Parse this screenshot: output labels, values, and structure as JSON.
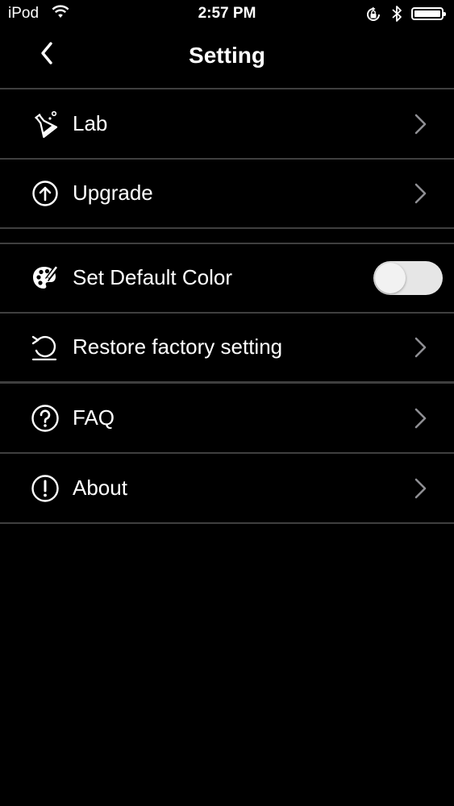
{
  "status": {
    "carrier": "iPod",
    "time": "2:57 PM",
    "wifi_icon": "wifi-icon",
    "lock_icon": "rotation-lock-icon",
    "bluetooth_icon": "bluetooth-icon",
    "battery_level": 1.0
  },
  "nav": {
    "title": "Setting",
    "back_icon": "chevron-left-icon"
  },
  "settings": [
    {
      "label": "Lab",
      "icon": "flask-icon",
      "accessory": "chevron"
    },
    {
      "label": "Upgrade",
      "icon": "upload-arrow-icon",
      "accessory": "chevron"
    },
    {
      "label": "Set Default Color",
      "icon": "palette-icon",
      "accessory": "toggle",
      "toggle_on": false
    },
    {
      "label": "Restore factory setting",
      "icon": "restore-icon",
      "accessory": "chevron"
    },
    {
      "label": "FAQ",
      "icon": "question-icon",
      "accessory": "chevron"
    },
    {
      "label": "About",
      "icon": "info-icon",
      "accessory": "chevron"
    }
  ],
  "colors": {
    "background": "#000000",
    "text": "#ffffff",
    "divider": "#3f3f3f",
    "chevron": "#8e8e93",
    "toggle_track": "#e6e6e6"
  }
}
